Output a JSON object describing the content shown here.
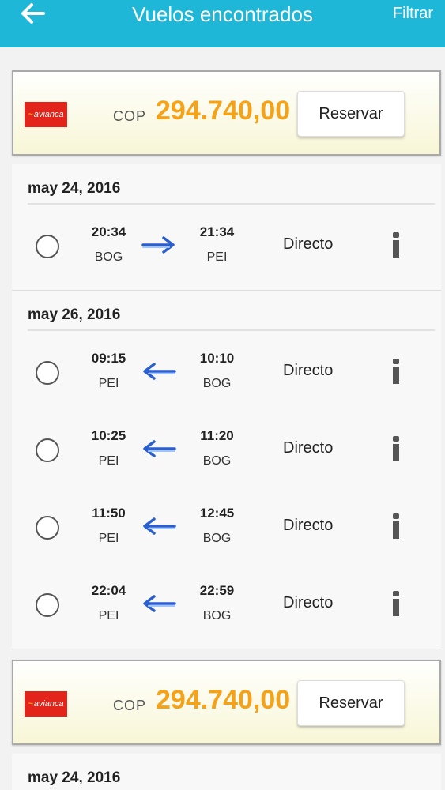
{
  "header": {
    "title": "Vuelos encontrados",
    "filter_label": "Filtrar",
    "back_icon": "arrow-left-icon"
  },
  "offers": [
    {
      "airline_logo_text": "avianca",
      "currency": "COP",
      "price": "294.740,00",
      "reserve_label": "Reservar",
      "days": [
        {
          "date": "may 24, 2016",
          "direction": "outbound",
          "flights": [
            {
              "dep_time": "20:34",
              "dep_code": "BOG",
              "arr_time": "21:34",
              "arr_code": "PEI",
              "stop_type": "Directo"
            }
          ]
        },
        {
          "date": "may 26, 2016",
          "direction": "return",
          "flights": [
            {
              "dep_time": "09:15",
              "dep_code": "PEI",
              "arr_time": "10:10",
              "arr_code": "BOG",
              "stop_type": "Directo"
            },
            {
              "dep_time": "10:25",
              "dep_code": "PEI",
              "arr_time": "11:20",
              "arr_code": "BOG",
              "stop_type": "Directo"
            },
            {
              "dep_time": "11:50",
              "dep_code": "PEI",
              "arr_time": "12:45",
              "arr_code": "BOG",
              "stop_type": "Directo"
            },
            {
              "dep_time": "22:04",
              "dep_code": "PEI",
              "arr_time": "22:59",
              "arr_code": "BOG",
              "stop_type": "Directo"
            }
          ]
        }
      ]
    },
    {
      "airline_logo_text": "avianca",
      "currency": "COP",
      "price": "294.740,00",
      "reserve_label": "Reservar",
      "days": [
        {
          "date": "may 24, 2016",
          "direction": "outbound",
          "flights": []
        }
      ]
    }
  ],
  "colors": {
    "header_bg": "#1fb7d8",
    "price": "#f5a21b",
    "airline_red": "#e3241b",
    "arrow_blue": "#2b5fd0"
  }
}
